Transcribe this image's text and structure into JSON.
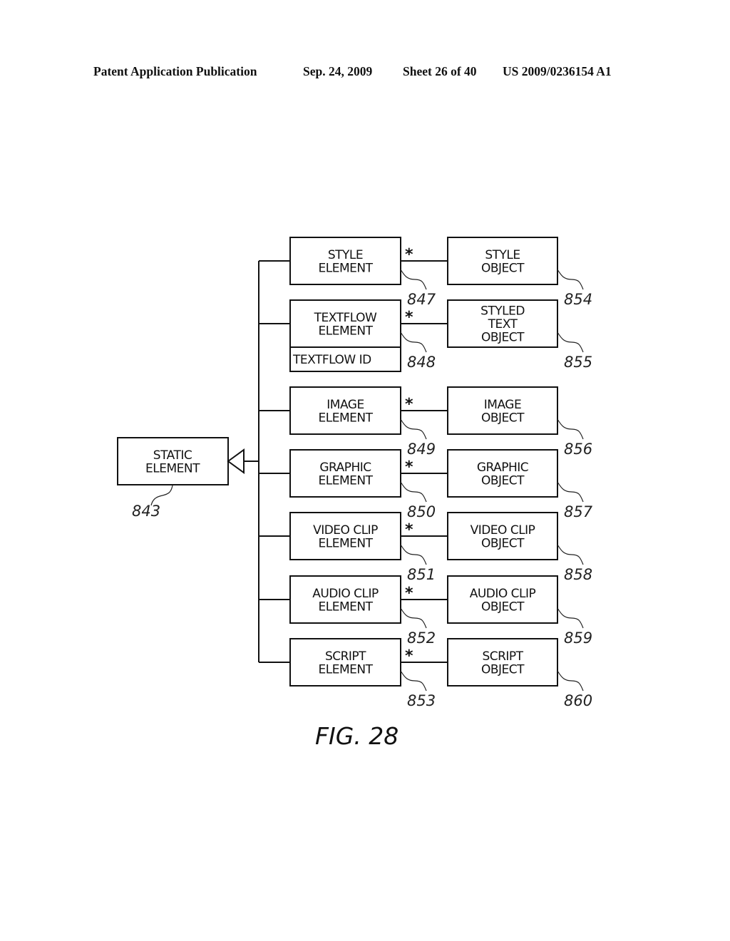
{
  "header": {
    "left": "Patent Application Publication",
    "date": "Sep. 24, 2009",
    "sheet": "Sheet 26 of 40",
    "pub_number": "US 2009/0236154 A1"
  },
  "diagram": {
    "root": {
      "lines": [
        "STATIC",
        "ELEMENT"
      ],
      "ref": "843"
    },
    "multiplicity": "*",
    "rows": [
      {
        "element": {
          "lines": [
            "STYLE",
            "ELEMENT"
          ],
          "ref": "847"
        },
        "object": {
          "lines": [
            "STYLE",
            "OBJECT"
          ],
          "ref": "854"
        }
      },
      {
        "element": {
          "lines": [
            "TEXTFLOW",
            "ELEMENT"
          ],
          "ref": "848",
          "attribute": "TEXTFLOW ID"
        },
        "object": {
          "lines": [
            "STYLED",
            "TEXT",
            "OBJECT"
          ],
          "ref": "855"
        }
      },
      {
        "element": {
          "lines": [
            "IMAGE",
            "ELEMENT"
          ],
          "ref": "849"
        },
        "object": {
          "lines": [
            "IMAGE",
            "OBJECT"
          ],
          "ref": "856"
        }
      },
      {
        "element": {
          "lines": [
            "GRAPHIC",
            "ELEMENT"
          ],
          "ref": "850"
        },
        "object": {
          "lines": [
            "GRAPHIC",
            "OBJECT"
          ],
          "ref": "857"
        }
      },
      {
        "element": {
          "lines": [
            "VIDEO CLIP",
            "ELEMENT"
          ],
          "ref": "851"
        },
        "object": {
          "lines": [
            "VIDEO CLIP",
            "OBJECT"
          ],
          "ref": "858"
        }
      },
      {
        "element": {
          "lines": [
            "AUDIO CLIP",
            "ELEMENT"
          ],
          "ref": "852"
        },
        "object": {
          "lines": [
            "AUDIO CLIP",
            "OBJECT"
          ],
          "ref": "859"
        }
      },
      {
        "element": {
          "lines": [
            "SCRIPT",
            "ELEMENT"
          ],
          "ref": "853"
        },
        "object": {
          "lines": [
            "SCRIPT",
            "OBJECT"
          ],
          "ref": "860"
        }
      }
    ],
    "figure_label": "FIG. 28"
  }
}
